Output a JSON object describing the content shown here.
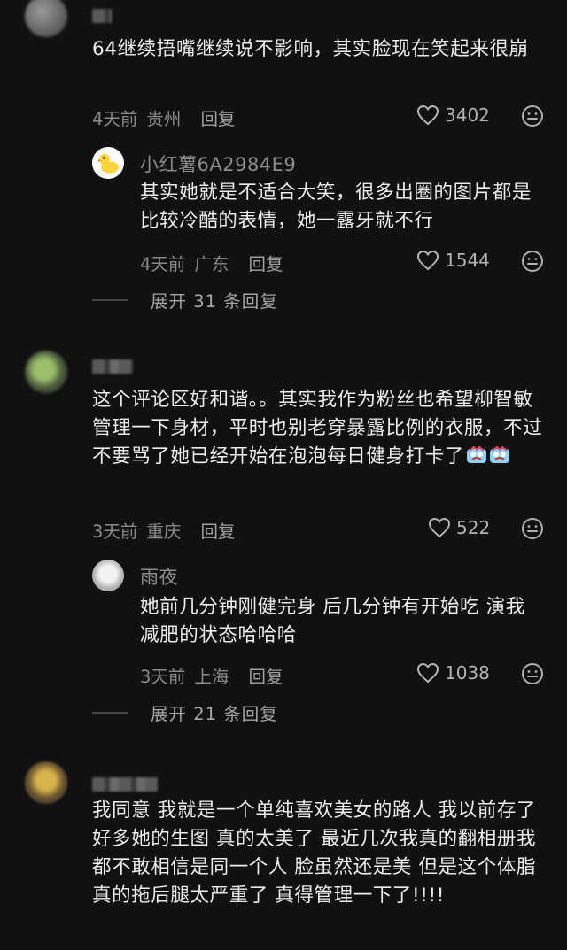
{
  "comments": [
    {
      "text": "64继续捂嘴继续说不影响，其实脸现在笑起来很崩",
      "time": "4天前",
      "location": "贵州",
      "reply_label": "回复",
      "likes": "3402",
      "sub_reply": {
        "name": "小红薯6A2984E9",
        "text": "其实她就是不适合大笑，很多出圈的图片都是比较冷酷的表情，她一露牙就不行",
        "time": "4天前",
        "location": "广东",
        "reply_label": "回复",
        "likes": "1544"
      },
      "expand_label": "展开 31 条回复"
    },
    {
      "text": "这个评论区好和谐。。其实我作为粉丝也希望柳智敏管理一下身材，平时也别老穿暴露比例的衣服，不过不要骂了她已经开始在泡泡每日健身打卡了",
      "time": "3天前",
      "location": "重庆",
      "reply_label": "回复",
      "likes": "522",
      "sub_reply": {
        "name": "雨夜",
        "text": "她前几分钟刚健完身 后几分钟有开始吃 演我减肥的状态哈哈哈",
        "time": "3天前",
        "location": "上海",
        "reply_label": "回复",
        "likes": "1038"
      },
      "expand_label": "展开 21 条回复"
    },
    {
      "text": "我同意 我就是一个单纯喜欢美女的路人 我以前存了好多她的生图 真的太美了 最近几次我真的翻相册我都不敢相信是同一个人 脸虽然还是美 但是这个体脂真的拖后腿太严重了 真得管理一下了!!!!"
    }
  ],
  "icons": {
    "like": "heart-outline-icon",
    "emoji": "smiley-face-icon",
    "avatar_duck": "duck-avatar-icon"
  },
  "colors": {
    "background": "#111111",
    "text": "#ececec",
    "meta": "#8a8a8a"
  }
}
